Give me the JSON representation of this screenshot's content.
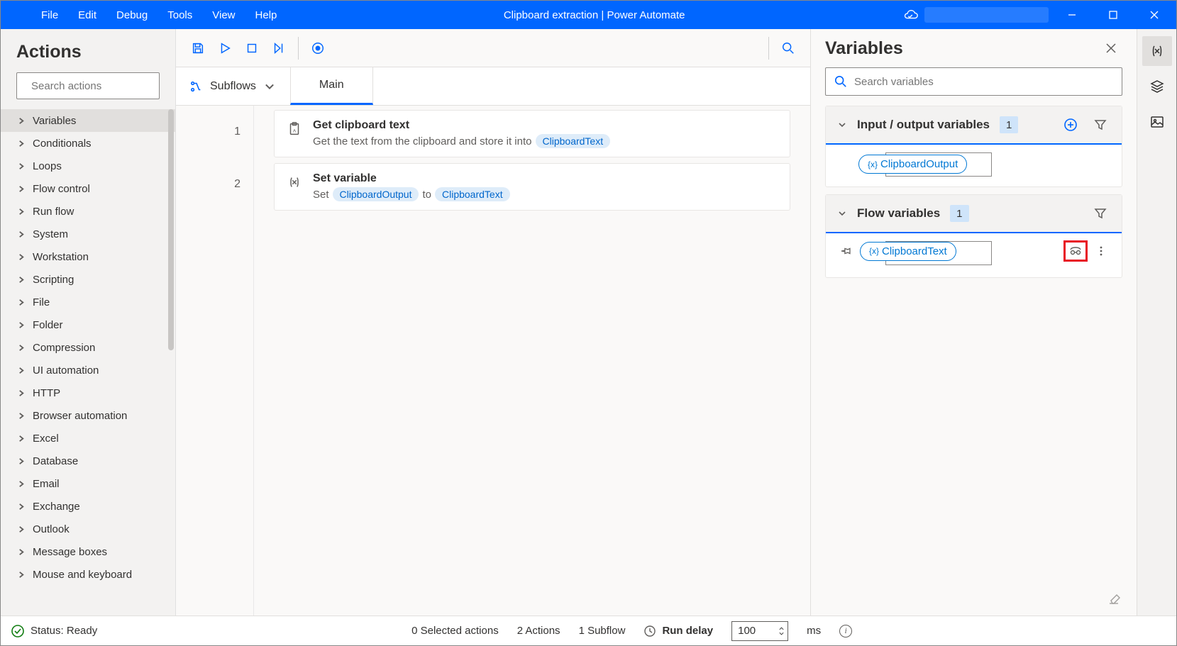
{
  "menu": {
    "file": "File",
    "edit": "Edit",
    "debug": "Debug",
    "tools": "Tools",
    "view": "View",
    "help": "Help"
  },
  "window_title": "Clipboard extraction | Power Automate",
  "actions_panel": {
    "title": "Actions",
    "search_placeholder": "Search actions",
    "categories": [
      "Variables",
      "Conditionals",
      "Loops",
      "Flow control",
      "Run flow",
      "System",
      "Workstation",
      "Scripting",
      "File",
      "Folder",
      "Compression",
      "UI automation",
      "HTTP",
      "Browser automation",
      "Excel",
      "Database",
      "Email",
      "Exchange",
      "Outlook",
      "Message boxes",
      "Mouse and keyboard"
    ]
  },
  "designer": {
    "subflows_label": "Subflows",
    "tab_main": "Main",
    "steps": [
      {
        "line": "1",
        "title": "Get clipboard text",
        "desc_pre": "Get the text from the clipboard and store it into",
        "chip": "ClipboardText"
      },
      {
        "line": "2",
        "title": "Set variable",
        "desc_pre": "Set",
        "chip1": "ClipboardOutput",
        "mid": "to",
        "chip2": "ClipboardText"
      }
    ]
  },
  "vars_panel": {
    "title": "Variables",
    "search_placeholder": "Search variables",
    "io_section": {
      "title": "Input / output variables",
      "count": "1",
      "chip": "ClipboardOutput"
    },
    "flow_section": {
      "title": "Flow variables",
      "count": "1",
      "chip": "ClipboardText"
    }
  },
  "status": {
    "ready": "Status: Ready",
    "sel": "0 Selected actions",
    "actions": "2 Actions",
    "subflows": "1 Subflow",
    "delay_label": "Run delay",
    "delay_value": "100",
    "ms": "ms"
  }
}
